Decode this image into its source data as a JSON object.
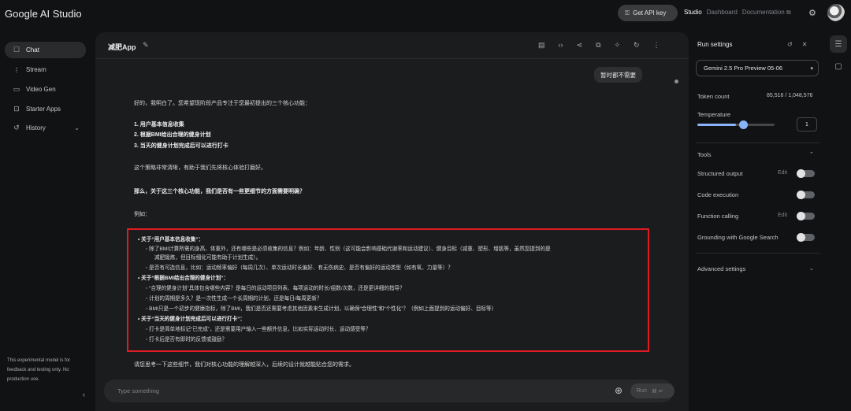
{
  "header": {
    "logo": "Google AI Studio",
    "api_key_label": "Get API key",
    "links": [
      "Studio",
      "Dashboard",
      "Documentation"
    ]
  },
  "sidebar": {
    "items": [
      {
        "label": "Chat",
        "icon": "chat-icon"
      },
      {
        "label": "Stream",
        "icon": "stream-icon"
      },
      {
        "label": "Video Gen",
        "icon": "video-icon"
      },
      {
        "label": "Starter Apps",
        "icon": "apps-icon"
      },
      {
        "label": "History",
        "icon": "history-icon"
      }
    ],
    "note": "This experimental model is for feedback and testing only. No production use."
  },
  "chat": {
    "app_title": "减肥App",
    "user_message": "暂时都不需要",
    "response": {
      "intro": "好的，我明白了。您希望现阶段产品专注于您最初提出的三个核心功能：",
      "list": [
        "1. 用户基本信息收集",
        "2. 根据BMI给出合理的健身计划",
        "3. 当天的健身计划完成后可以进行打卡"
      ],
      "p2": "这个策略非常清晰，有助于我们先将核心体验打磨好。",
      "p3": "那么，关于这三个核心功能，我们是否有一些更细节的方面需要明确？",
      "p4": "例如：",
      "boxed": [
        {
          "text": "• 关于“用户基本信息收集”：",
          "kind": "b"
        },
        {
          "text": "◦ 除了BMI计算所需的身高、体重外，还有哪些是必须收集的信息？例如：年龄、性别（这可能会影响基础代谢率和运动建议）、健身目标（减重、塑形、增肌等，虽然您提到的是",
          "kind": "sub"
        },
        {
          "text": "减肥锻炼，但目标细化可能有助于计划生成）。",
          "kind": "cont"
        },
        {
          "text": "◦ 是否有可选信息，比如：运动频率偏好（每周几次）、单次运动时长偏好、有无伤病史、是否有偏好的运动类型（如有氧、力量等）？",
          "kind": "sub"
        },
        {
          "text": "• 关于“根据BMI给出合理的健身计划”：",
          "kind": "b"
        },
        {
          "text": "◦ “合理的健身计划”具体包含哪些内容？是每日的运动项目列表、每项运动的时长/组数/次数，还是更详细的指导？",
          "kind": "sub"
        },
        {
          "text": "◦ 计划的周期是多久？是一次性生成一个长周期的计划，还是每日/每周更新？",
          "kind": "sub"
        },
        {
          "text": "◦ BMI只是一个初步的健康指标，除了BMI，我们是否还需要考虑其他因素来生成计划，以确保“合理性”和“个性化”？（例如上面提到的运动偏好、目标等）",
          "kind": "sub"
        },
        {
          "text": "• 关于“当天的健身计划完成后可以进行打卡”：",
          "kind": "b"
        },
        {
          "text": "◦ 打卡是简单地标记“已完成”，还是需要用户输入一些额外信息，比如实际运动时长、运动感受等？",
          "kind": "sub"
        },
        {
          "text": "◦ 打卡后是否有即时的反馈或鼓励？",
          "kind": "sub"
        }
      ],
      "closing": "请您思考一下这些细节，我们对核心功能的理解越深入，后续的设计就越能贴合您的需求。"
    },
    "input_placeholder": "Type something",
    "run_label": "Run",
    "run_shortcut": "⌘ ↵"
  },
  "run_settings": {
    "title": "Run settings",
    "model": "Gemini 2.5 Pro Preview 05-06",
    "token_count_label": "Token count",
    "token_count_value": "85,516 / 1,048,576",
    "temperature_label": "Temperature",
    "temperature_value": "1",
    "temperature_level": 0.5,
    "tools_label": "Tools",
    "tools": [
      {
        "label": "Structured output",
        "edit": "Edit"
      },
      {
        "label": "Code execution",
        "edit": ""
      },
      {
        "label": "Function calling",
        "edit": "Edit"
      },
      {
        "label": "Grounding with Google Search",
        "edit": ""
      }
    ],
    "advanced_label": "Advanced settings"
  },
  "colors": {
    "accent": "#8ab4f8",
    "highlight_box": "#e01b24",
    "background": "#111214",
    "panel": "#1b1c1d"
  }
}
